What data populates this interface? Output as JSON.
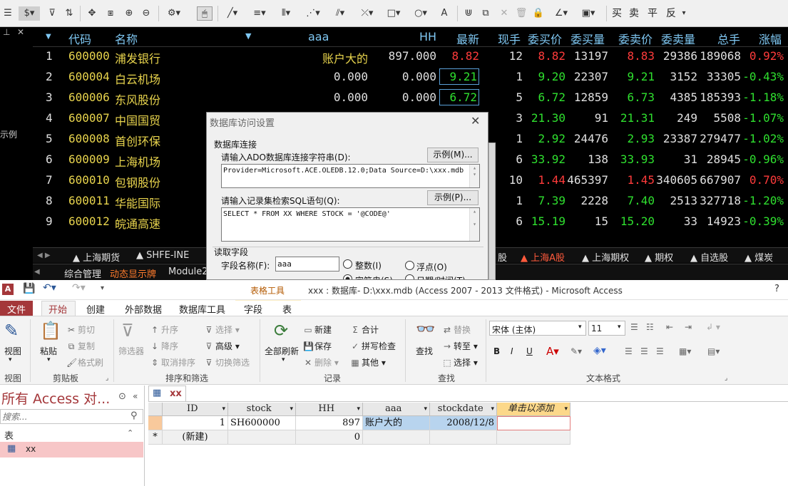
{
  "trading": {
    "toolbar_right_buttons": [
      "买",
      "卖",
      "平",
      "反"
    ],
    "left_side_text": "示例",
    "columns": [
      "代码",
      "名称",
      "aaa",
      "HH",
      "最新",
      "现手",
      "委买价",
      "委买量",
      "委卖价",
      "委卖量",
      "总手",
      "涨幅"
    ],
    "rows": [
      {
        "n": "1",
        "code": "600000",
        "name": "浦发银行",
        "aaa": "账户大的",
        "hh": "897.000",
        "last": "8.82",
        "vol": "12",
        "bid": "8.82",
        "bidq": "13197",
        "ask": "8.83",
        "askq": "29386",
        "total": "189068",
        "chg": "0.92%"
      },
      {
        "n": "2",
        "code": "600004",
        "name": "白云机场",
        "aaa": "0.000",
        "hh": "0.000",
        "last": "9.21",
        "vol": "1",
        "bid": "9.20",
        "bidq": "22307",
        "ask": "9.21",
        "askq": "3152",
        "total": "33305",
        "chg": "-0.43%"
      },
      {
        "n": "3",
        "code": "600006",
        "name": "东风股份",
        "aaa": "0.000",
        "hh": "0.000",
        "last": "6.72",
        "vol": "5",
        "bid": "6.72",
        "bidq": "12859",
        "ask": "6.73",
        "askq": "4385",
        "total": "185393",
        "chg": "-1.18%"
      },
      {
        "n": "4",
        "code": "600007",
        "name": "中国国贸",
        "aaa": "",
        "hh": "",
        "last": "",
        "vol": "3",
        "bid": "21.30",
        "bidq": "91",
        "ask": "21.31",
        "askq": "249",
        "total": "5508",
        "chg": "-1.07%"
      },
      {
        "n": "5",
        "code": "600008",
        "name": "首创环保",
        "aaa": "",
        "hh": "",
        "last": "",
        "vol": "1",
        "bid": "2.92",
        "bidq": "24476",
        "ask": "2.93",
        "askq": "23387",
        "total": "279477",
        "chg": "-1.02%"
      },
      {
        "n": "6",
        "code": "600009",
        "name": "上海机场",
        "aaa": "",
        "hh": "",
        "last": "",
        "vol": "6",
        "bid": "33.92",
        "bidq": "138",
        "ask": "33.93",
        "askq": "31",
        "total": "28945",
        "chg": "-0.96%"
      },
      {
        "n": "7",
        "code": "600010",
        "name": "包钢股份",
        "aaa": "",
        "hh": "",
        "last": "",
        "vol": "10",
        "bid": "1.44",
        "bidq": "465397",
        "ask": "1.45",
        "askq": "340605",
        "total": "667907",
        "chg": "0.70%"
      },
      {
        "n": "8",
        "code": "600011",
        "name": "华能国际",
        "aaa": "",
        "hh": "",
        "last": "",
        "vol": "1",
        "bid": "7.39",
        "bidq": "2228",
        "ask": "7.40",
        "askq": "2513",
        "total": "327718",
        "chg": "-1.20%"
      },
      {
        "n": "9",
        "code": "600012",
        "name": "皖通高速",
        "aaa": "",
        "hh": "",
        "last": "",
        "vol": "6",
        "bid": "15.19",
        "bidq": "15",
        "ask": "15.20",
        "askq": "33",
        "total": "14923",
        "chg": "-0.39%"
      }
    ],
    "market_tabs": [
      "上海期货",
      "SHFE-INE",
      "股",
      "上海A股",
      "上海期权",
      "期权",
      "自选股",
      "煤炭"
    ],
    "bottom_tabs": [
      "综合管理",
      "动态显示牌",
      "Module2"
    ],
    "colors": {
      "up": "#ff3b3b",
      "down": "#2fe02f",
      "code": "#e8d44d",
      "header": "#7fc7f2",
      "active_tab": "#ff7b2c"
    }
  },
  "dialog": {
    "title": "数据库访问设置",
    "group_connection": "数据库连接",
    "conn_label": "请输入ADO数据库连接字符串(D):",
    "conn_example": "示例(M)...",
    "conn_value": "Provider=Microsoft.ACE.OLEDB.12.0;Data Source=D:\\xxx.mdb",
    "sql_label": "请输入记录集检索SQL语句(Q):",
    "sql_example": "示例(P)...",
    "sql_value": "SELECT * FROM XX WHERE STOCK = '@CODE@'",
    "group_field": "读取字段",
    "field_name_label": "字段名称(F):",
    "field_name_value": "aaa",
    "radio_int": "整数(I)",
    "radio_float": "浮点(O)",
    "radio_string": "字符串(S)",
    "radio_datetime": "日期/时间(T)"
  },
  "access": {
    "logo": "A",
    "title": "xxx : 数据库- D:\\xxx.mdb (Access 2007 - 2013 文件格式) - Microsoft Access",
    "context_tab": "表格工具",
    "help": "?",
    "ribbon_tabs": [
      "文件",
      "开始",
      "创建",
      "外部数据",
      "数据库工具",
      "字段",
      "表"
    ],
    "groups": {
      "view": {
        "label": "视图",
        "buttons": [
          "视图"
        ]
      },
      "clipboard": {
        "label": "剪贴板",
        "paste": "粘贴",
        "cut": "剪切",
        "copy": "复制",
        "format_painter": "格式刷"
      },
      "sort_filter": {
        "label": "排序和筛选",
        "filter": "筛选器",
        "asc": "升序",
        "desc": "降序",
        "remove_sort": "取消排序",
        "select": "选择",
        "advanced": "高级",
        "toggle": "切换筛选"
      },
      "records": {
        "label": "记录",
        "refresh": "全部刷新",
        "new": "新建",
        "save": "保存",
        "delete": "删除",
        "total": "合计",
        "spell": "拼写检查",
        "other": "其他"
      },
      "find": {
        "label": "查找",
        "find": "查找",
        "replace": "替换",
        "goto": "转至",
        "select": "选择"
      },
      "text_format": {
        "label": "文本格式",
        "font": "宋体 (主体)",
        "size": "11",
        "bold": "B",
        "italic": "I",
        "underline": "U"
      }
    },
    "nav": {
      "title": "所有 Access 对...",
      "search_placeholder": "搜索...",
      "section": "表",
      "item": "xx"
    },
    "table": {
      "tab": "xx",
      "columns": [
        "ID",
        "stock",
        "HH",
        "aaa",
        "stockdate",
        "单击以添加"
      ],
      "row": {
        "id": "1",
        "stock": "SH600000",
        "hh": "897",
        "aaa": "账户大的",
        "date": "2008/12/8"
      },
      "new_row": {
        "marker": "*",
        "label": "(新建)",
        "hh": "0"
      }
    }
  }
}
